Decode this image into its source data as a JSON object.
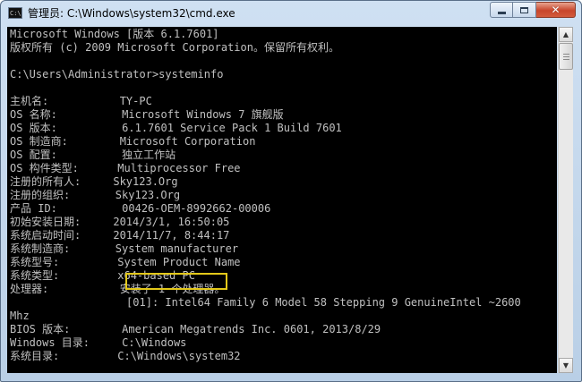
{
  "window": {
    "title": "管理员: C:\\Windows\\system32\\cmd.exe",
    "icon_text": "C:\\",
    "controls": {
      "minimize": "minimize",
      "maximize": "maximize",
      "close": "✕"
    }
  },
  "console": {
    "lines": [
      "Microsoft Windows [版本 6.1.7601]",
      "版权所有 (c) 2009 Microsoft Corporation。保留所有权利。",
      "",
      "C:\\Users\\Administrator>systeminfo",
      "",
      "主机名:           TY-PC",
      "OS 名称:          Microsoft Windows 7 旗舰版",
      "OS 版本:          6.1.7601 Service Pack 1 Build 7601",
      "OS 制造商:        Microsoft Corporation",
      "OS 配置:          独立工作站",
      "OS 构件类型:      Multiprocessor Free",
      "注册的所有人:     Sky123.Org",
      "注册的组织:       Sky123.Org",
      "产品 ID:          00426-OEM-8992662-00006",
      "初始安装日期:     2014/3/1, 16:50:05",
      "系统启动时间:     2014/11/7, 8:44:17",
      "系统制造商:       System manufacturer",
      "系统型号:         System Product Name",
      "系统类型:         x64-based PC",
      "处理器:           安装了 1 个处理器。",
      "                  [01]: Intel64 Family 6 Model 58 Stepping 9 GenuineIntel ~2600",
      "Mhz",
      "BIOS 版本:        American Megatrends Inc. 0601, 2013/8/29",
      "Windows 目录:     C:\\Windows",
      "系统目录:         C:\\Windows\\system32"
    ]
  },
  "highlight": {
    "label": "x64-based PC"
  },
  "colors": {
    "console_bg": "#000000",
    "console_fg": "#c0c0c0",
    "highlight": "#e3c81a",
    "close": "#c8452b"
  }
}
